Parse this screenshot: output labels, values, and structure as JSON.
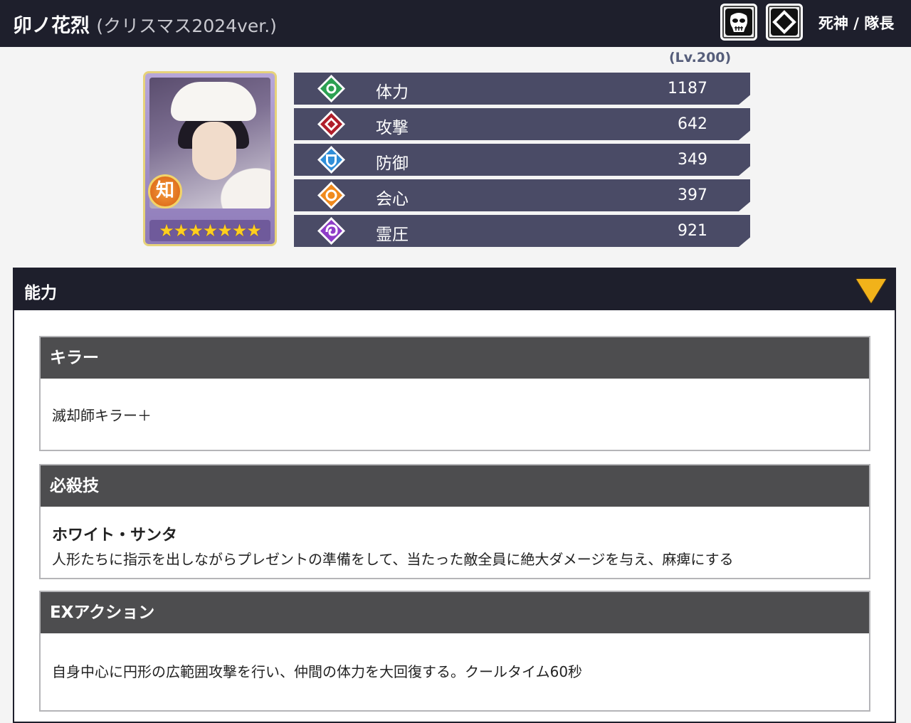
{
  "header": {
    "name": "卯ノ花烈",
    "variant": "(クリスマス2024ver.)",
    "attribute_icons": [
      "hollow-mask-icon",
      "diamond-icon"
    ],
    "faction": "死神 / 隊長",
    "background": "#1e1f2c"
  },
  "card": {
    "type_badge": "知",
    "stars": "★★★★★★★",
    "rarity": 7
  },
  "level": "(Lv.200)",
  "stats": [
    {
      "key": "hp",
      "label": "体力",
      "value": "1187",
      "icon": "hp-gem-icon",
      "color": "#2ca052"
    },
    {
      "key": "atk",
      "label": "攻撃",
      "value": "642",
      "icon": "attack-gem-icon",
      "color": "#b01e2a"
    },
    {
      "key": "def",
      "label": "防御",
      "value": "349",
      "icon": "defense-gem-icon",
      "color": "#2f8ed8"
    },
    {
      "key": "crit",
      "label": "会心",
      "value": "397",
      "icon": "critical-gem-icon",
      "color": "#f08a1d"
    },
    {
      "key": "reiatsu",
      "label": "霊圧",
      "value": "921",
      "icon": "reiatsu-gem-icon",
      "color": "#8e3cc8"
    }
  ],
  "panel": {
    "title": "能力",
    "sections": [
      {
        "heading": "キラー",
        "name": "",
        "description": "滅却師キラー＋"
      },
      {
        "heading": "必殺技",
        "name": "ホワイト・サンタ",
        "description": "人形たちに指示を出しながらプレゼントの準備をして、当たった敵全員に絶大ダメージを与え、麻痺にする"
      },
      {
        "heading": "EXアクション",
        "name": "",
        "description": "自身中心に円形の広範囲攻撃を行い、仲間の体力を大回復する。クールタイム60秒"
      }
    ]
  }
}
